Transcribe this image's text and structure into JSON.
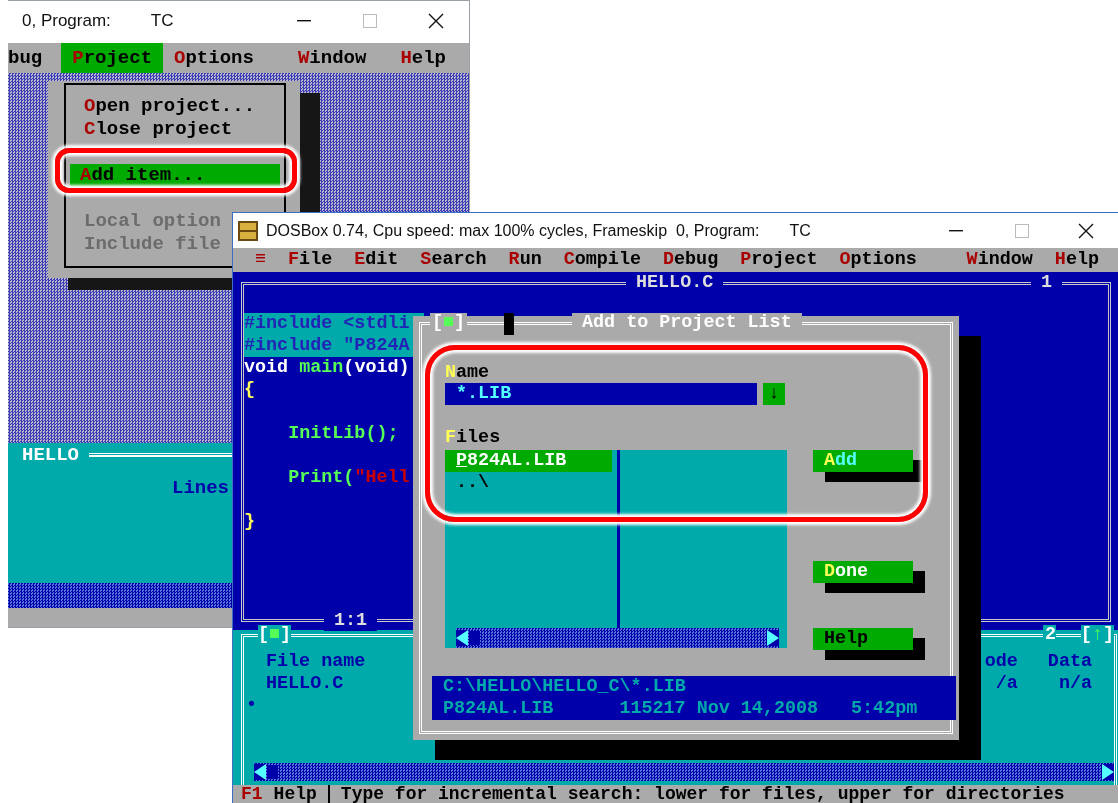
{
  "back_window": {
    "title": "0, Program:",
    "program": "TC",
    "menu": [
      {
        "rest": "bug",
        "selected": false
      },
      {
        "hotkey": "P",
        "rest": "roject",
        "selected": true
      },
      {
        "hotkey": "O",
        "rest": "ptions",
        "selected": false
      },
      {
        "hotkey": "W",
        "rest": "indow",
        "selected": false
      },
      {
        "hotkey": "H",
        "rest": "elp",
        "selected": false
      }
    ],
    "dropdown": [
      {
        "kind": "item",
        "hotkey": "O",
        "rest": "pen project...",
        "selected": false,
        "disabled": false
      },
      {
        "kind": "item",
        "hotkey": "C",
        "rest": "lose project",
        "selected": false,
        "disabled": false
      },
      {
        "kind": "separator"
      },
      {
        "kind": "item",
        "hotkey": "A",
        "rest": "dd item...",
        "selected": true,
        "disabled": false
      },
      {
        "kind": "item",
        "rest": "Local option",
        "selected": false,
        "disabled": true
      },
      {
        "kind": "item",
        "rest": "Include file",
        "selected": false,
        "disabled": true
      }
    ],
    "output_window": {
      "title": "HELLO",
      "text": "Lines"
    }
  },
  "front_window": {
    "title": "DOSBox 0.74, Cpu speed: max 100% cycles, Frameskip  0, Program:",
    "program": "TC",
    "menu": [
      {
        "hotkey": "≡",
        "selected": false
      },
      {
        "hotkey": "F",
        "rest": "ile",
        "selected": false
      },
      {
        "hotkey": "E",
        "rest": "dit",
        "selected": false
      },
      {
        "hotkey": "S",
        "rest": "earch",
        "selected": false
      },
      {
        "hotkey": "R",
        "rest": "un",
        "selected": false
      },
      {
        "hotkey": "C",
        "rest": "ompile",
        "selected": false
      },
      {
        "hotkey": "D",
        "rest": "ebug",
        "selected": false
      },
      {
        "hotkey": "P",
        "rest": "roject",
        "selected": false
      },
      {
        "hotkey": "O",
        "rest": "ptions",
        "selected": false
      },
      {
        "hotkey": "W",
        "rest": "indow",
        "selected": false
      },
      {
        "hotkey": "H",
        "rest": "elp",
        "selected": false
      }
    ],
    "editor": {
      "title": "HELLO.C",
      "window_number": "1",
      "position": "1:1",
      "lines": [
        {
          "selected": true,
          "segments": [
            {
              "kind": "directive",
              "text": "#include <stdli"
            }
          ]
        },
        {
          "selected": true,
          "segments": [
            {
              "kind": "directive",
              "text": "#include \"P824A"
            }
          ]
        },
        {
          "selected": false,
          "segments": [
            {
              "kind": "keyword",
              "text": "void "
            },
            {
              "kind": "ident",
              "text": "main"
            },
            {
              "kind": "keyword",
              "text": "(void)"
            }
          ]
        },
        {
          "selected": false,
          "segments": [
            {
              "kind": "brace",
              "text": "{"
            }
          ]
        },
        {
          "selected": false
        },
        {
          "selected": false,
          "segments": [
            {
              "kind": "ident",
              "text": "    InitLib();"
            }
          ]
        },
        {
          "selected": false
        },
        {
          "selected": false,
          "segments": [
            {
              "kind": "ident",
              "text": "    Print("
            },
            {
              "kind": "string",
              "text": "\"Hell"
            }
          ]
        },
        {
          "selected": false
        },
        {
          "selected": false,
          "segments": [
            {
              "kind": "brace",
              "text": "}"
            }
          ]
        }
      ]
    },
    "dialog": {
      "title": "Add to Project List",
      "close_box": "[■]",
      "name_field": {
        "label": {
          "hotkey": "N",
          "rest": "ame"
        },
        "value": "*.LIB",
        "history_button": "↓"
      },
      "files": {
        "label": {
          "hotkey": "F",
          "rest": "iles"
        },
        "items": [
          {
            "text": "P824AL.LIB",
            "selected": true
          },
          {
            "text": "..\\",
            "selected": false
          }
        ]
      },
      "buttons": [
        {
          "hotkey": "A",
          "rest": "dd",
          "default": true
        },
        {
          "hotkey": "D",
          "rest": "one",
          "default": false
        },
        {
          "rest": "Help",
          "default": false
        }
      ],
      "info": {
        "path": "C:\\HELLO\\HELLO_C\\*.LIB",
        "file": "P824AL.LIB",
        "size_date": "115217 Nov 14,2008",
        "time": "5:42pm"
      }
    },
    "message_window": {
      "close_box": "[■]",
      "window_number": "2",
      "zoom_box": "[↑]",
      "columns": [
        {
          "heading": "File name",
          "value": "HELLO.C"
        },
        {
          "heading": "ode",
          "value": "/a"
        },
        {
          "heading": "Data",
          "value": "n/a"
        }
      ],
      "marker": "•"
    },
    "status_bar": {
      "key": "F1",
      "key_label": "Help",
      "hint": "Type for incremental search: lower for files, upper for directories"
    }
  }
}
